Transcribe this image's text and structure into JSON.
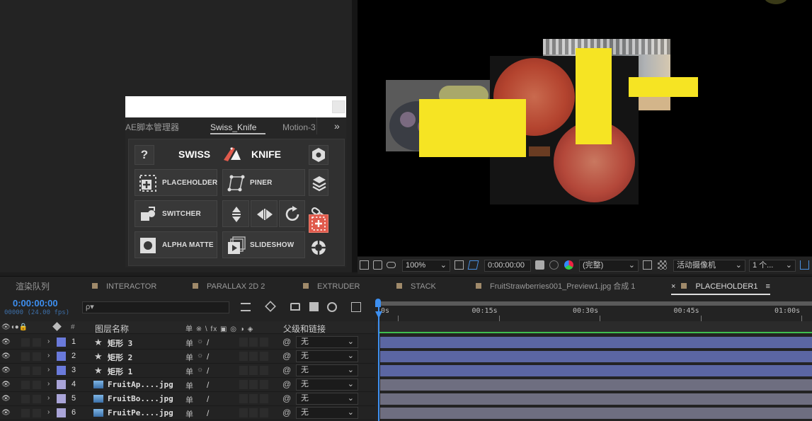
{
  "script_window": {
    "tabs": [
      "AE脚本管理器",
      "Swiss_Knife",
      "Motion-3"
    ],
    "active_tab_menu": "≡",
    "more": "»",
    "header": {
      "help": "?",
      "swiss": "SWISS",
      "knife": "KNIFE"
    },
    "tools": {
      "placeholder": "PLACEHOLDER",
      "piner": "PINER",
      "switcher": "SWITCHER",
      "alpha_matte": "ALPHA MATTE",
      "slideshow": "SLIDESHOW"
    },
    "accent": "#e05a4c"
  },
  "viewer": {
    "zoom": "100%",
    "timecode": "0:00:00:00",
    "resolution": "(完整)",
    "camera": "活动摄像机",
    "views": "1 个...",
    "placeholder_color": "#f6e423"
  },
  "timeline": {
    "tabs": [
      {
        "label": "渲染队列",
        "color": ""
      },
      {
        "label": "INTERACTOR",
        "color": "#a08a6a"
      },
      {
        "label": "PARALLAX 2D 2",
        "color": "#a08a6a"
      },
      {
        "label": "EXTRUDER",
        "color": "#a08a6a"
      },
      {
        "label": "STACK",
        "color": "#a08a6a"
      },
      {
        "label": "FruitStrawberries001_Preview1.jpg 合成 1",
        "color": "#a08a6a"
      },
      {
        "label": "PLACEHOLDER1",
        "color": "#a08a6a"
      }
    ],
    "close_mark": "×",
    "tab_menu": "≡",
    "current_time": "0:00:00:00",
    "frame_info": "00000 (24.00 fps)",
    "search_placeholder": "ρ▾",
    "columns": {
      "num": "#",
      "name": "图层名称",
      "switches": "单 ※ \\ fx ▣ ◎ ◑ ◈",
      "parent": "父级和链接"
    },
    "ruler": [
      "0s",
      "00:15s",
      "00:30s",
      "00:45s",
      "01:00s"
    ],
    "layers": [
      {
        "num": "1",
        "name": "矩形 3",
        "type": "shape",
        "label_color": "#6a7adb",
        "parent": "无"
      },
      {
        "num": "2",
        "name": "矩形 2",
        "type": "shape",
        "label_color": "#6a7adb",
        "parent": "无"
      },
      {
        "num": "3",
        "name": "矩形 1",
        "type": "shape",
        "label_color": "#6a7adb",
        "parent": "无"
      },
      {
        "num": "4",
        "name": "FruitAp....jpg",
        "type": "footage",
        "label_color": "#a9a4d8",
        "parent": "无"
      },
      {
        "num": "5",
        "name": "FruitBo....jpg",
        "type": "footage",
        "label_color": "#a9a4d8",
        "parent": "无"
      },
      {
        "num": "6",
        "name": "FruitPe....jpg",
        "type": "footage",
        "label_color": "#a9a4d8",
        "parent": "无"
      }
    ],
    "bar_colors": {
      "shape": "#5b66a3",
      "footage": "#6e6e80"
    }
  }
}
